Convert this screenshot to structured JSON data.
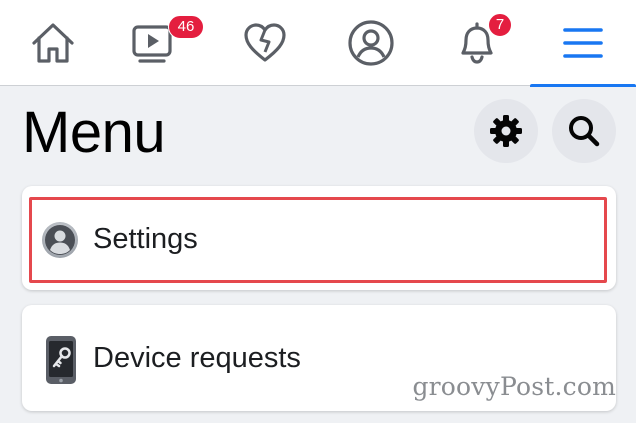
{
  "nav": {
    "items": [
      {
        "id": "home",
        "icon": "home-icon"
      },
      {
        "id": "watch",
        "icon": "video-icon",
        "badge": "46"
      },
      {
        "id": "dating",
        "icon": "heart-icon"
      },
      {
        "id": "profile",
        "icon": "profile-icon"
      },
      {
        "id": "notifications",
        "icon": "bell-icon",
        "badge": "7"
      },
      {
        "id": "menu",
        "icon": "hamburger-icon",
        "active": true
      }
    ]
  },
  "header": {
    "title": "Menu",
    "settings_icon": "gear-icon",
    "search_icon": "search-icon"
  },
  "menu_items": [
    {
      "label": "Settings",
      "icon": "profile-circle-icon",
      "highlighted": true
    },
    {
      "label": "Device requests",
      "icon": "phone-key-icon"
    }
  ],
  "watermark": "groovyPost.com",
  "colors": {
    "accent": "#1877f2",
    "badge": "#e41e3f",
    "highlight_border": "#e5484d",
    "background": "#eff1f4"
  }
}
